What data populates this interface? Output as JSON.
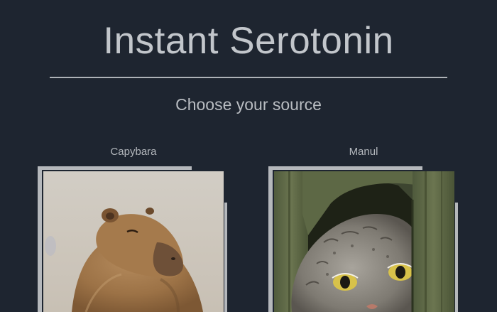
{
  "header": {
    "title": "Instant Serotonin",
    "subtitle": "Choose your source"
  },
  "sources": [
    {
      "label": "Capybara",
      "image_icon": "capybara-photo"
    },
    {
      "label": "Manul",
      "image_icon": "manul-photo"
    }
  ],
  "colors": {
    "background": "#1e2530",
    "text": "#c2c6cb",
    "frame": "#b5b8bc"
  }
}
